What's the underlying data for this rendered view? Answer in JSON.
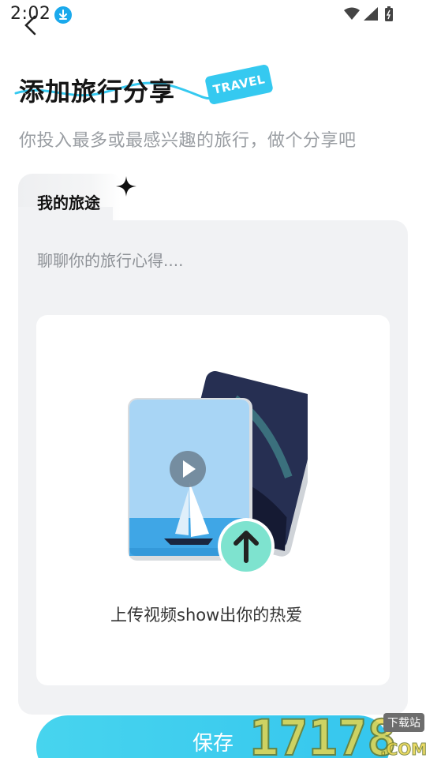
{
  "status_bar": {
    "time": "2:02",
    "icons": [
      "download-icon",
      "wifi-icon",
      "signal-icon",
      "battery-icon"
    ]
  },
  "header": {
    "back_icon": "back-chevron-icon"
  },
  "page": {
    "title": "添加旅行分享",
    "tag": "TRAVEL",
    "subtitle": "你投入最多或最感兴趣的旅行，做个分享吧"
  },
  "card": {
    "tab_label": "我的旅途",
    "tab_icon": "sparkle-icon",
    "note_placeholder": "聊聊你的旅行心得....",
    "note_value": "",
    "upload_label": "上传视频show出你的热爱",
    "upload_icon": "upload-arrow-icon"
  },
  "actions": {
    "save_label": "保存"
  },
  "watermark": {
    "main": "17178",
    "domain": ".COM",
    "sub": "下载站"
  },
  "colors": {
    "accent": "#3ccbef",
    "card_bg": "#f1f2f4",
    "subtitle": "#9a9ea3",
    "upload_badge": "#7ee3cf"
  }
}
